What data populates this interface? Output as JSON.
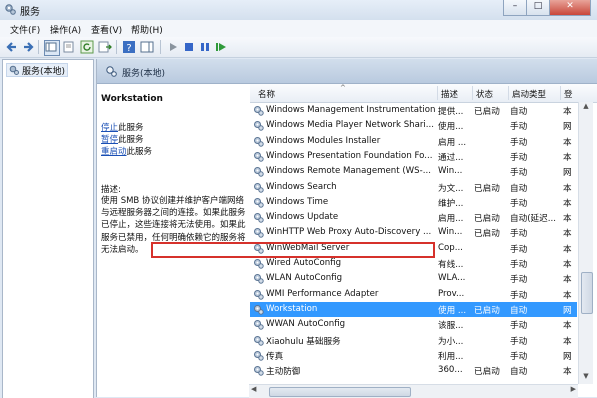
{
  "window": {
    "title": "服务"
  },
  "menu": [
    "文件(F)",
    "操作(A)",
    "查看(V)",
    "帮助(H)"
  ],
  "tree": {
    "item": "服务(本地)"
  },
  "pane_header": "服务(本地)",
  "detail": {
    "service_name": "Workstation",
    "actions": [
      {
        "link": "停止",
        "rest": "此服务"
      },
      {
        "link": "暂停",
        "rest": "此服务"
      },
      {
        "link": "重启动",
        "rest": "此服务"
      }
    ],
    "desc_label": "描述:",
    "desc_text": "使用 SMB 协议创建并维护客户端网络与远程服务器之间的连接。如果此服务已停止，这些连接将无法使用。如果此服务已禁用，任何明确依赖它的服务将无法启动。"
  },
  "columns": {
    "name": "名称",
    "desc": "描述",
    "status": "状态",
    "startup": "启动类型",
    "logon": "登"
  },
  "services": [
    {
      "name": "Windows Management Instrumentation",
      "desc": "提供...",
      "status": "已启动",
      "startup": "自动",
      "logon": "本"
    },
    {
      "name": "Windows Media Player Network Shari...",
      "desc": "使用...",
      "status": "",
      "startup": "手动",
      "logon": "网"
    },
    {
      "name": "Windows Modules Installer",
      "desc": "启用 ...",
      "status": "",
      "startup": "手动",
      "logon": "本"
    },
    {
      "name": "Windows Presentation Foundation Fo...",
      "desc": "通过...",
      "status": "",
      "startup": "手动",
      "logon": "本"
    },
    {
      "name": "Windows Remote Management (WS-...",
      "desc": "Win...",
      "status": "",
      "startup": "手动",
      "logon": "网"
    },
    {
      "name": "Windows Search",
      "desc": "为文...",
      "status": "已启动",
      "startup": "自动",
      "logon": "本"
    },
    {
      "name": "Windows Time",
      "desc": "维护...",
      "status": "",
      "startup": "手动",
      "logon": "本"
    },
    {
      "name": "Windows Update",
      "desc": "启用...",
      "status": "已启动",
      "startup": "自动(延迟...",
      "logon": "本"
    },
    {
      "name": "WinHTTP Web Proxy Auto-Discovery ...",
      "desc": "Win...",
      "status": "已启动",
      "startup": "手动",
      "logon": "本"
    },
    {
      "name": "WinWebMail Server",
      "desc": "Cop...",
      "status": "",
      "startup": "手动",
      "logon": "本"
    },
    {
      "name": "Wired AutoConfig",
      "desc": "有线...",
      "status": "",
      "startup": "手动",
      "logon": "本"
    },
    {
      "name": "WLAN AutoConfig",
      "desc": "WLA...",
      "status": "",
      "startup": "手动",
      "logon": "本"
    },
    {
      "name": "WMI Performance Adapter",
      "desc": "Prov...",
      "status": "",
      "startup": "手动",
      "logon": "本"
    },
    {
      "name": "Workstation",
      "desc": "使用 ...",
      "status": "已启动",
      "startup": "自动",
      "logon": "网",
      "selected": true
    },
    {
      "name": "WWAN AutoConfig",
      "desc": "该服...",
      "status": "",
      "startup": "手动",
      "logon": "本"
    },
    {
      "name": "Xiaohulu 基础服务",
      "desc": "为小...",
      "status": "",
      "startup": "手动",
      "logon": "本"
    },
    {
      "name": "传真",
      "desc": "利用...",
      "status": "",
      "startup": "手动",
      "logon": "网"
    },
    {
      "name": "主动防御",
      "desc": "360...",
      "status": "已启动",
      "startup": "自动",
      "logon": "本"
    }
  ],
  "colors": {
    "selection": "#3399ff",
    "highlight_border": "#d6312b",
    "link": "#1a4fb5"
  }
}
